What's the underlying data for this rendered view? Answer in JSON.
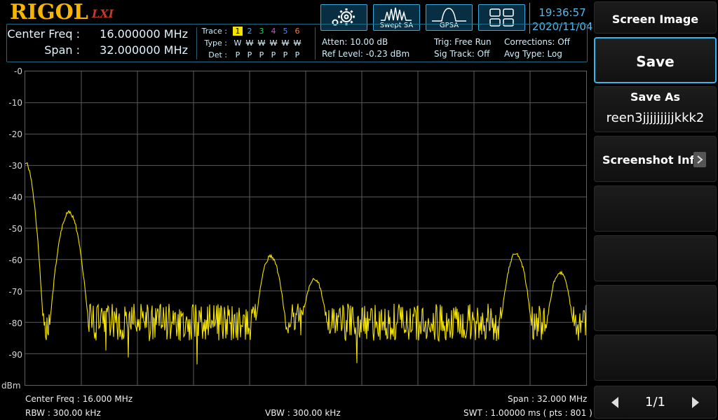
{
  "brand": {
    "logo": "RIGOL",
    "lxi": "LXI"
  },
  "header": {
    "center_freq_label": "Center Freq :",
    "center_freq_value": "16.000000 MHz",
    "span_label": "Span :",
    "span_value": "32.000000 MHz",
    "trace_label": "Trace :",
    "type_label": "Type :",
    "det_label": "Det :",
    "traces": [
      {
        "num": "1",
        "type": "W",
        "det": "P",
        "color": "#f5e400"
      },
      {
        "num": "2",
        "type": "W",
        "det": "P",
        "color": "#3aa7ff"
      },
      {
        "num": "3",
        "type": "W",
        "det": "P",
        "color": "#28d05a"
      },
      {
        "num": "4",
        "type": "W",
        "det": "P",
        "color": "#e040e0"
      },
      {
        "num": "5",
        "type": "W",
        "det": "P",
        "color": "#4a8cff"
      },
      {
        "num": "6",
        "type": "W",
        "det": "P",
        "color": "#ff7a30"
      }
    ],
    "atten": "Atten: 10.00 dB",
    "ref_level": "Ref Level: -0.23 dBm",
    "trig": "Trig: Free Run",
    "sig_track": "Sig Track: Off",
    "corrections": "Corrections: Off",
    "avg_type": "Avg Type: Log"
  },
  "mode_buttons": [
    {
      "icon": "gear-icon",
      "label": ""
    },
    {
      "icon": "swept-sa-icon",
      "label": "Swept SA"
    },
    {
      "icon": "gpsa-icon",
      "label": "GPSA"
    },
    {
      "icon": "grid-layout-icon",
      "label": ""
    }
  ],
  "clock": {
    "time": "19:36:57",
    "date": "2020/11/04"
  },
  "graph": {
    "y_labels": [
      "-0",
      "-10",
      "-20",
      "-30",
      "-40",
      "-50",
      "-60",
      "-70",
      "-80",
      "-90"
    ],
    "unit": "dBm",
    "trace_color": "#f5e400",
    "peaks": [
      {
        "freq_mhz": 0.0,
        "level_dbm": -29
      },
      {
        "freq_mhz": 2.5,
        "level_dbm": -45
      },
      {
        "freq_mhz": 14.0,
        "level_dbm": -59
      },
      {
        "freq_mhz": 16.5,
        "level_dbm": -66
      },
      {
        "freq_mhz": 28.0,
        "level_dbm": -58
      },
      {
        "freq_mhz": 30.5,
        "level_dbm": -64
      }
    ],
    "noise_floor_dbm": -80
  },
  "footer": {
    "center_freq": "Center Freq : 16.000 MHz",
    "span": "Span : 32.000 MHz",
    "rbw": "RBW : 300.00 kHz",
    "vbw": "VBW : 300.00 kHz",
    "swt": "SWT : 1.00000 ms ( pts : 801 )"
  },
  "menu": {
    "title": "Screen Image",
    "save": "Save",
    "save_as_label": "Save As",
    "save_as_value": "reen3jjjjjjjjjkkk2",
    "screenshot_info": "Screenshot Info",
    "page": "1/1"
  }
}
